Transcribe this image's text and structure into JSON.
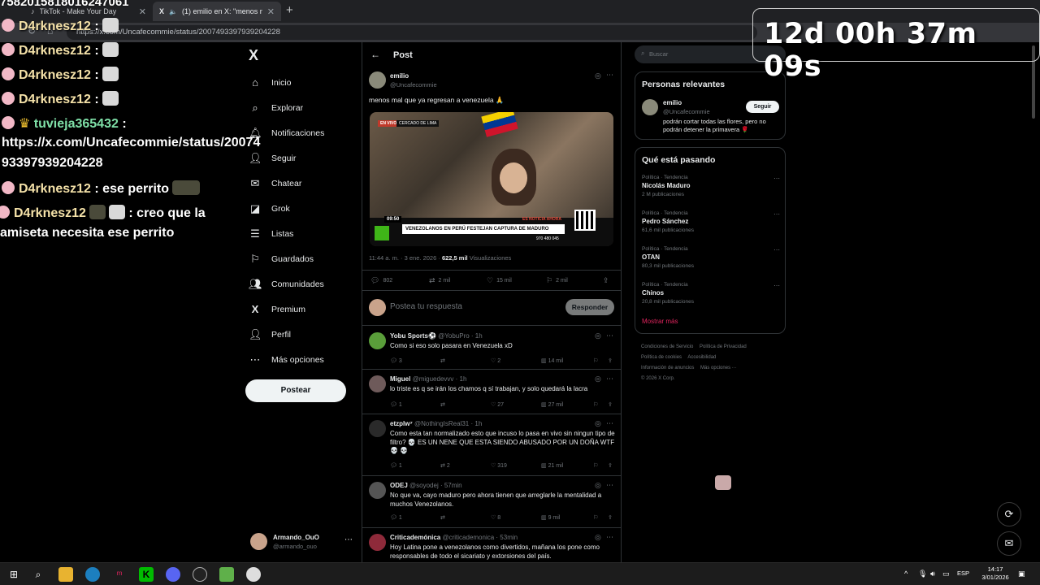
{
  "browser": {
    "tabs": [
      {
        "title": "TikTok - Make Your Day"
      },
      {
        "title": "(1) emilio en X: \"menos mal q"
      }
    ],
    "new_tab": "+",
    "url": "https://x.com/Uncafecommie/status/2007493397939204228"
  },
  "overlay": {
    "top_text": "7582015818016247061",
    "timer": "12d 00h 37m 09s",
    "chat": [
      {
        "user": "D4rknesz12",
        "text": ":"
      },
      {
        "user": "D4rknesz12",
        "text": ":"
      },
      {
        "user": "D4rknesz12",
        "text": ":"
      },
      {
        "user": "D4rknesz12",
        "text": ":"
      },
      {
        "user": "tuvieja365432",
        "text": ":"
      },
      {
        "user": "",
        "text": "https://x.com/Uncafecommie/status/20074"
      },
      {
        "user": "",
        "text": "93397939204228"
      },
      {
        "user": "D4rknesz12",
        "text": ": ese perrito"
      },
      {
        "user": "D4rknesz12",
        "text": ": creo que la"
      },
      {
        "user": "",
        "text": "amiseta necesita ese perrito"
      }
    ]
  },
  "sidebar": {
    "logo": "X",
    "items": [
      {
        "label": "Inicio",
        "icon": "home-icon"
      },
      {
        "label": "Explorar",
        "icon": "search-icon"
      },
      {
        "label": "Notificaciones",
        "icon": "bell-icon"
      },
      {
        "label": "Seguir",
        "icon": "follow-icon"
      },
      {
        "label": "Chatear",
        "icon": "mail-icon"
      },
      {
        "label": "Grok",
        "icon": "grok-icon"
      },
      {
        "label": "Listas",
        "icon": "list-icon"
      },
      {
        "label": "Guardados",
        "icon": "bookmark-icon"
      },
      {
        "label": "Comunidades",
        "icon": "communities-icon"
      },
      {
        "label": "Premium",
        "icon": "x-icon"
      },
      {
        "label": "Perfil",
        "icon": "profile-icon"
      },
      {
        "label": "Más opciones",
        "icon": "more-icon"
      }
    ],
    "post_button": "Postear",
    "account": {
      "name": "Armando_OuO",
      "handle": "@armando_ouo"
    }
  },
  "main": {
    "header": "Post",
    "post": {
      "name": "emilio",
      "handle": "@Uncafecommie",
      "text": "menos mal que ya regresan a venezuela 🙏",
      "media": {
        "live_badge": "EN VIVO",
        "location": "CERCADO DE LIMA",
        "time": "09:50",
        "breaking": "ES NOTICIA AHORA",
        "headline": "VENEZOLANOS EN PERÚ FESTEJAN CAPTURA DE MADURO",
        "phone": "970 480 045"
      },
      "timestamp": "11:44 a. m. · 3 ene. 2026 ·",
      "views_count": "622,5 mil",
      "views_label": "Visualizaciones",
      "stats": {
        "replies": "802",
        "reposts": "2 mil",
        "likes": "15 mil",
        "bookmarks": "2 mil"
      }
    },
    "reply_box": {
      "placeholder": "Postea tu respuesta",
      "button": "Responder"
    },
    "replies": [
      {
        "name": "Yobu Sports⚽",
        "handle": "@YobuPro · 1h",
        "text": "Como si eso solo pasara en Venezuela xD",
        "replies": "3",
        "reposts": "",
        "likes": "2",
        "views": "14 mil"
      },
      {
        "name": "Miguel",
        "handle": "@miguedevvv · 1h",
        "text": "lo triste es q se irán los chamos q sí trabajan, y solo quedará la lacra",
        "replies": "1",
        "reposts": "",
        "likes": "27",
        "views": "27 mil"
      },
      {
        "name": "etzplw⁷",
        "handle": "@NothingIsReal31 · 1h",
        "text": "Como esta tan normalizado esto que incuso lo pasa en vivo sin ningun tipo de filtro? 💀 ES UN NENE QUE ESTA SIENDO ABUSADO POR UN DOÑA WTF 💀 💀",
        "replies": "1",
        "reposts": "2",
        "likes": "319",
        "views": "21 mil"
      },
      {
        "name": "ODEJ",
        "handle": "@soyodej · 57min",
        "text": "No que va, cayo maduro pero ahora tienen que arreglarle la mentalidad a muchos Venezolanos.",
        "replies": "1",
        "reposts": "",
        "likes": "8",
        "views": "9 mil"
      },
      {
        "name": "Criticademónica",
        "handle": "@criticademonica · 53min",
        "text": "Hoy Latina pone a venezolanos como divertidos, mañana los pone como responsables de todo el sicariato y extorsiones del país.",
        "replies": "",
        "reposts": "",
        "likes": "",
        "views": ""
      }
    ]
  },
  "right": {
    "search_placeholder": "Buscar",
    "relevant": {
      "title": "Personas relevantes",
      "name": "emilio",
      "handle": "@Uncafecommie",
      "bio": "podrán cortar todas las flores, pero no podrán detener la primavera 🌹",
      "follow": "Seguir"
    },
    "trends": {
      "title": "Qué está pasando",
      "items": [
        {
          "cat": "Política · Tendencia",
          "name": "Nicolás Maduro",
          "count": "2 M publicaciones"
        },
        {
          "cat": "Política · Tendencia",
          "name": "Pedro Sánchez",
          "count": "61,6 mil publicaciones"
        },
        {
          "cat": "Política · Tendencia",
          "name": "OTAN",
          "count": "80,3 mil publicaciones"
        },
        {
          "cat": "Política · Tendencia",
          "name": "Chinos",
          "count": "20,8 mil publicaciones"
        }
      ],
      "more": "Mostrar más"
    },
    "footer": [
      "Condiciones de Servicio",
      "Política de Privacidad",
      "Política de cookies",
      "Accesibilidad",
      "Información de anuncios",
      "Más opciones ···",
      "© 2026 X Corp."
    ]
  },
  "taskbar": {
    "lang": "ESP",
    "time": "14:17",
    "date": "3/01/2026"
  }
}
